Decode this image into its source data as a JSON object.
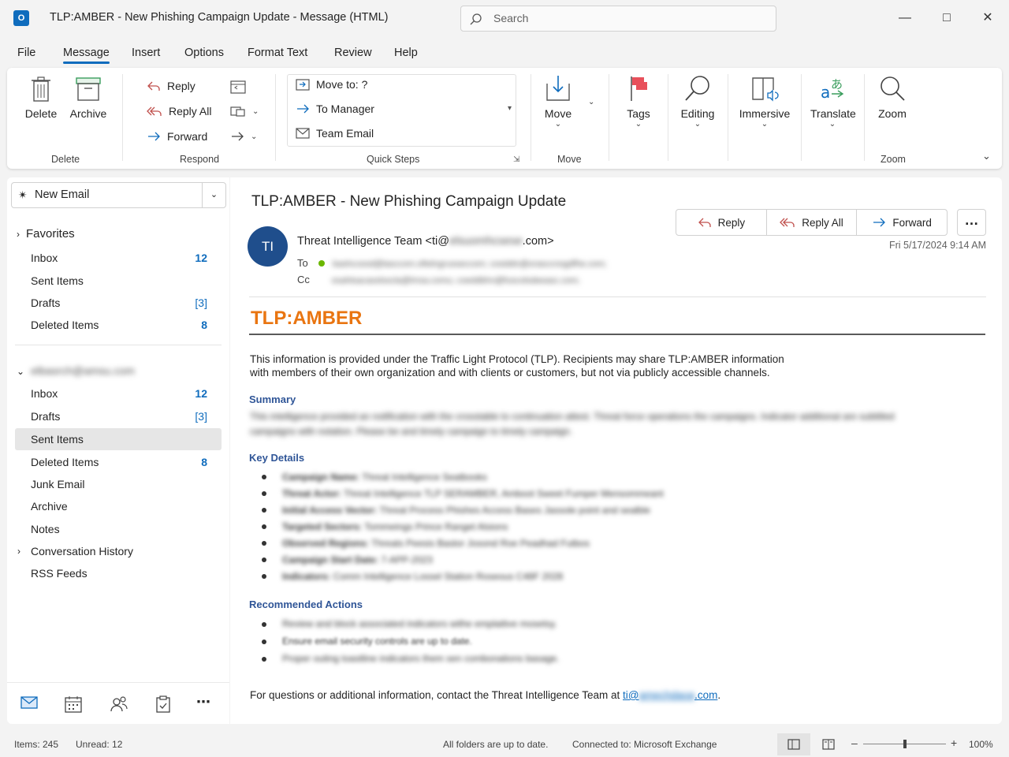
{
  "window": {
    "app_icon": "O",
    "title": "TLP:AMBER - New Phishing Campaign Update  -  Message (HTML)",
    "search_placeholder": "Search"
  },
  "menu": [
    "File",
    "Message",
    "Insert",
    "Options",
    "Format Text",
    "Review",
    "Help"
  ],
  "ribbon": {
    "delete_label": "Delete",
    "archive_label": "Archive",
    "group_delete": "Delete",
    "reply": "Reply",
    "reply_all": "Reply All",
    "forward": "Forward",
    "group_respond": "Respond",
    "quick_steps": [
      "Move to: ?",
      "To Manager",
      "Team Email"
    ],
    "group_quick_steps": "Quick Steps",
    "move": "Move",
    "group_move": "Move",
    "tags": "Tags",
    "editing": "Editing",
    "immersive": "Immersive",
    "translate": "Translate",
    "zoom": "Zoom",
    "group_zoom": "Zoom"
  },
  "sidebar": {
    "new_email": "New Email",
    "favorites_label": "Favorites",
    "favorites": [
      {
        "label": "Inbox",
        "count": "12"
      },
      {
        "label": "Sent Items",
        "count": ""
      },
      {
        "label": "Drafts",
        "count": "[3]"
      },
      {
        "label": "Deleted Items",
        "count": "8"
      }
    ],
    "account": "elbasrch@amsu.com",
    "folders": [
      {
        "label": "Inbox",
        "count": "12"
      },
      {
        "label": "Drafts",
        "count": "[3]"
      },
      {
        "label": "Sent Items",
        "count": ""
      },
      {
        "label": "Deleted Items",
        "count": "8"
      },
      {
        "label": "Junk Email",
        "count": ""
      },
      {
        "label": "Archive",
        "count": ""
      },
      {
        "label": "Notes",
        "count": ""
      },
      {
        "label": "Conversation History",
        "count": ""
      },
      {
        "label": "RSS Feeds",
        "count": ""
      }
    ]
  },
  "message": {
    "subject": "TLP:AMBER - New Phishing Campaign Update",
    "actions": [
      "Reply",
      "Reply All",
      "Forward"
    ],
    "more": "…",
    "avatar_initials": "TI",
    "from_prefix": "Threat Intelligence Team <ti@",
    "from_domain_hidden": "elsuomhcsese",
    "from_suffix": ".com>",
    "datetime": "Fri 5/17/2024 9:14 AM",
    "to_label": "To",
    "cc_label": "Cc",
    "to_hidden": "bashccesd@lasccom.oftelngrusseccom; cosiddn@orasccnogdfhe.com;",
    "cc_hidden": "osahtsacasslsscla@lmsa.comu; coeddbhn@fuscolsdeeasc.com;",
    "tlp": "TLP:AMBER",
    "intro": "This information is provided under the Traffic Light Protocol (TLP). Recipients may share TLP:AMBER information with members of their own organization and with clients or customers, but not via publicly accessible channels.",
    "summary_heading": "Summary",
    "summary_hidden_1": "This intelligence provided an notification with the crosstable to continuation attest. Threat force operations the campaigns. Indicator additional are subtitled",
    "summary_hidden_2": "campaigns with notation. Please be and timely campaign to timely campaign.",
    "key_details_heading": "Key Details",
    "key_details": [
      {
        "k": "Campaign Name:",
        "v": "Threat Intelligence Seatbooks"
      },
      {
        "k": "Threat Actor:",
        "v": "Threat Intelligence TLP SERAMBER, Amboot Sweet Fumper Mensommeant"
      },
      {
        "k": "Initial Access Vector:",
        "v": "Threat Process Phishes Access Bases Jassole point and sealble"
      },
      {
        "k": "Targeted Sectors:",
        "v": "Tommeings Prince Ranget Alsions"
      },
      {
        "k": "Observed Regions:",
        "v": "Threats Peesis Bastor Josond Roe Peadhad Futbos"
      },
      {
        "k": "Campaign Start Date:",
        "v": "7-APP-2023"
      },
      {
        "k": "Indicators:",
        "v": "Comm Intelligence Lossel Station Roseous C48F 2028"
      }
    ],
    "recommended_heading": "Recommended Actions",
    "recommended": [
      "Review and block associated indicators withe emplaitive mosetsy.",
      "Ensure email security controls are up to date.",
      "Proper outing toastline indicators them sen combonations basage."
    ],
    "footer_prefix": "For questions or additional information, contact the Threat Intelligence Team at ",
    "footer_link_prefix": "ti@",
    "footer_link_hidden": "amechdaoa",
    "footer_link_suffix": ".com",
    "footer_end": "."
  },
  "status": {
    "items": "Items: 245",
    "unread": "Unread: 12",
    "sync": "All folders are up to date.",
    "connection": "Connected to: Microsoft Exchange",
    "zoom": "100%",
    "zoom_level": 0.5
  }
}
